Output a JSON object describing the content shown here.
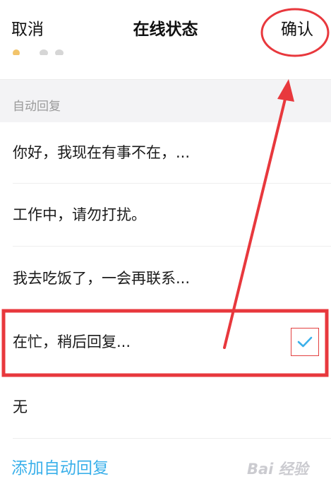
{
  "nav": {
    "cancel_label": "取消",
    "title": "在线状态",
    "confirm_label": "确认"
  },
  "section": {
    "label": "自动回复"
  },
  "replies": [
    {
      "text": "你好，我现在有事不在，...",
      "selected": false
    },
    {
      "text": "工作中，请勿打扰。",
      "selected": false
    },
    {
      "text": "我去吃饭了，一会再联系...",
      "selected": false
    },
    {
      "text": "在忙，稍后回复...",
      "selected": true
    },
    {
      "text": "无",
      "selected": false
    }
  ],
  "add_reply_label": "添加自动回复",
  "watermark": "Bai 经验",
  "icons": {
    "check": "checkmark-icon",
    "watermark_paw": "paw-icon"
  },
  "colors": {
    "accent": "#3bb0ea",
    "annotation": "#e8383d",
    "section_bg": "#f3f3f5",
    "section_text": "#9a9a9a"
  }
}
